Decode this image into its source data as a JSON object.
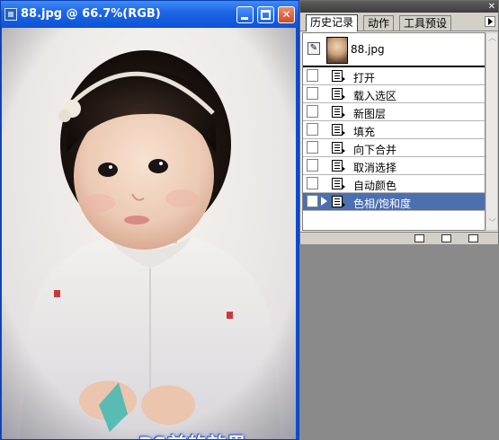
{
  "document": {
    "title": "88.jpg @ 66.7%(RGB)",
    "caption": "PS前的效果"
  },
  "history_panel": {
    "tabs": [
      {
        "label": "历史记录",
        "active": true
      },
      {
        "label": "动作",
        "active": false
      },
      {
        "label": "工具预设",
        "active": false
      }
    ],
    "snapshot": {
      "label": "88.jpg"
    },
    "steps": [
      {
        "label": "打开"
      },
      {
        "label": "载入选区"
      },
      {
        "label": "新图层"
      },
      {
        "label": "填充"
      },
      {
        "label": "向下合并"
      },
      {
        "label": "取消选择"
      },
      {
        "label": "自动颜色"
      },
      {
        "label": "色相/饱和度"
      }
    ],
    "selected_step": "色相/饱和度"
  },
  "colors": {
    "title_bar": "#0b52d6",
    "selected_row": "#4c6fb0",
    "workspace": "#8a8a8a"
  }
}
